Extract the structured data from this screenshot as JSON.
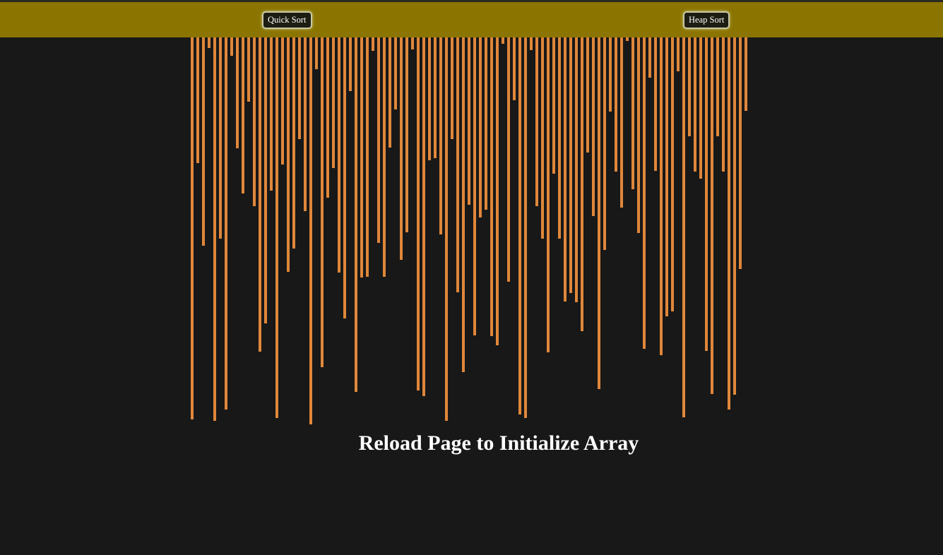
{
  "toolbar": {
    "quick_sort_label": "Quick Sort",
    "heap_sort_label": "Heap Sort"
  },
  "message": "Reload Page to Initialize Array",
  "colors": {
    "background": "#181818",
    "toolbar": "#8b7500",
    "bar": "#e0873a"
  },
  "array": {
    "values": [
      541,
      178,
      295,
      15,
      543,
      285,
      527,
      26,
      157,
      221,
      91,
      239,
      445,
      405,
      217,
      539,
      180,
      332,
      299,
      144,
      246,
      548,
      45,
      467,
      227,
      185,
      333,
      398,
      76,
      502,
      340,
      339,
      19,
      291,
      339,
      156,
      102,
      315,
      276,
      17,
      500,
      508,
      174,
      171,
      279,
      543,
      144,
      361,
      474,
      237,
      422,
      255,
      244,
      423,
      436,
      9,
      346,
      89,
      534,
      539,
      18,
      239,
      285,
      446,
      193,
      285,
      374,
      362,
      375,
      416,
      163,
      253,
      498,
      301,
      105,
      190,
      241,
      5,
      215,
      277,
      441,
      57,
      189,
      450,
      395,
      388,
      48,
      538,
      140,
      190,
      200,
      444,
      505,
      140,
      190,
      527,
      506,
      328,
      104
    ],
    "max": 560
  }
}
